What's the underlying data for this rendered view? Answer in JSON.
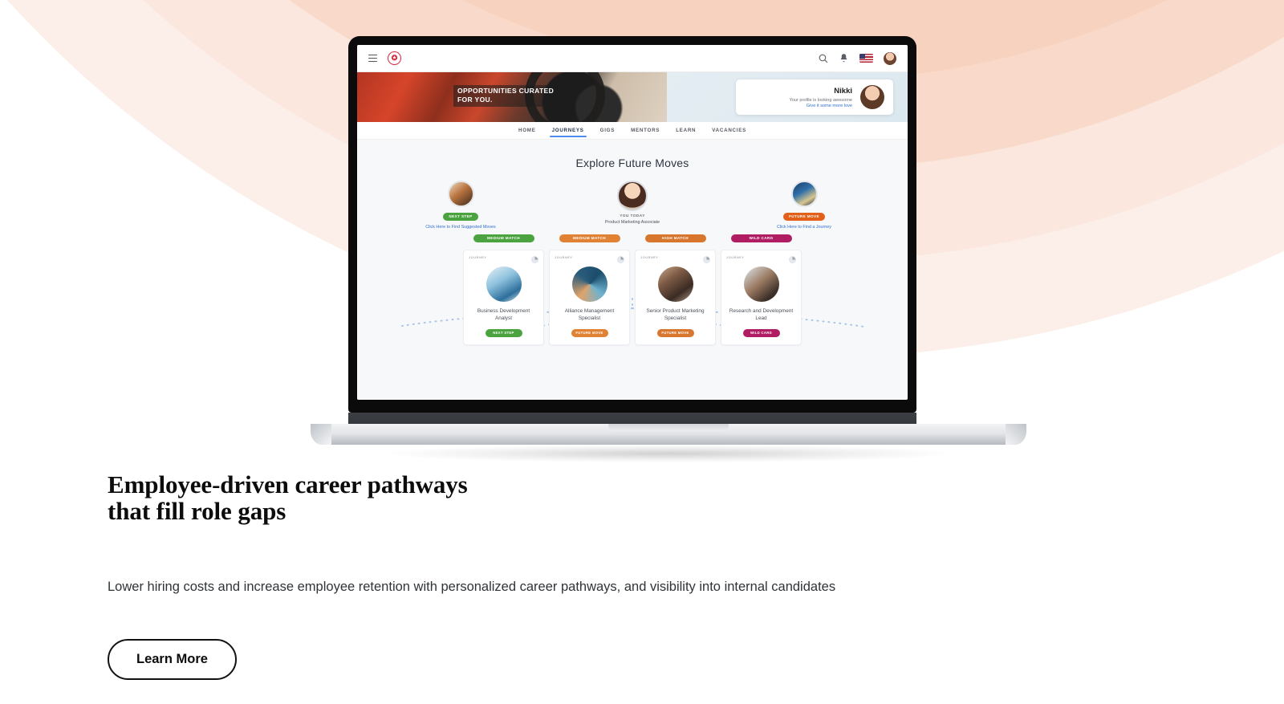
{
  "background": {
    "arc_colors": [
      "#FCEFE9",
      "#FBE7DE",
      "#F9D9C9",
      "#F7D2BF"
    ]
  },
  "device": {
    "type": "laptop-mockup"
  },
  "app": {
    "topbar": {
      "menu_icon": "hamburger-icon",
      "brand_icon": "brand-logo-icon",
      "brand_glyph": "✪",
      "search_icon": "search-icon",
      "bell_icon": "notification-bell-icon",
      "flag_icon": "us-flag-icon",
      "account_icon": "account-avatar-icon"
    },
    "hero": {
      "caption_line1": "OPPORTUNITIES CURATED",
      "caption_line2": "FOR YOU.",
      "profile": {
        "name": "Nikki",
        "subtitle": "Your profile is looking awesome",
        "link": "Give it some more love"
      }
    },
    "nav": {
      "tabs": [
        {
          "label": "HOME",
          "active": false
        },
        {
          "label": "JOURNEYS",
          "active": true
        },
        {
          "label": "GIGS",
          "active": false
        },
        {
          "label": "MENTORS",
          "active": false
        },
        {
          "label": "LEARN",
          "active": false
        },
        {
          "label": "VACANCIES",
          "active": false
        }
      ]
    },
    "main": {
      "title": "Explore Future Moves",
      "persons": [
        {
          "badge": "NEXT STEP",
          "badge_color": "#4aa33f",
          "caption": "",
          "label": "Click Here to Find Suggested Moves"
        },
        {
          "badge": "",
          "badge_color": "",
          "caption": "YOU TODAY",
          "label": "Product Marketing Associate"
        },
        {
          "badge": "FUTURE MOVE",
          "badge_color": "#e2601a",
          "caption": "",
          "label": "Click Here to Find a Journey"
        }
      ],
      "cards": [
        {
          "match_label": "MEDIUM MATCH",
          "match_color": "#4aa33f",
          "kicker": "JOURNEY",
          "title": "Business Development Analyst",
          "footer_label": "NEXT STEP",
          "footer_color": "#4aa33f"
        },
        {
          "match_label": "MEDIUM MATCH",
          "match_color": "#e08133",
          "kicker": "JOURNEY",
          "title": "Alliance Management Specialist",
          "footer_label": "FUTURE MOVE",
          "footer_color": "#e08133"
        },
        {
          "match_label": "HIGH MATCH",
          "match_color": "#d8762e",
          "kicker": "JOURNEY",
          "title": "Senior Product Marketing Specialist",
          "footer_label": "FUTURE MOVE",
          "footer_color": "#d8762e"
        },
        {
          "match_label": "WILD CARD",
          "match_color": "#b01d63",
          "kicker": "JOURNEY",
          "title": "Research and Development Lead",
          "footer_label": "WILD CARD",
          "footer_color": "#b01d63"
        }
      ]
    }
  },
  "section": {
    "headline_line1": "Employee-driven career pathways",
    "headline_line2": "that fill role gaps",
    "body": "Lower hiring costs and increase employee retention with personalized career pathways, and visibility into internal candidates",
    "cta_label": "Learn More"
  }
}
